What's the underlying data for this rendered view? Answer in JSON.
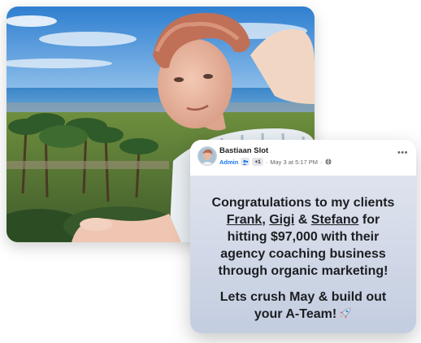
{
  "post": {
    "author": "Bastiaan Slot",
    "role_badge": "Admin",
    "member_count": "+1",
    "separator": "·",
    "date": "May 3 at 5:17 PM",
    "more_icon": "more-horizontal-icon",
    "text_line1": "Congratulations to my clients",
    "client1": "Frank",
    "comma": ", ",
    "client2": "Gigi",
    "amp": " & ",
    "client3": "Stefano",
    "text_line2_end": " for",
    "text_line3": "hitting $97,000 with their",
    "text_line4": "agency coaching business",
    "text_line5": "through organic marketing!",
    "text_line6": "Lets crush May & build out",
    "text_line7": "your A-Team!",
    "emoji": "rocket-icon"
  },
  "colors": {
    "facebook_blue": "#1877f2",
    "meta_gray": "#65676b",
    "text_dark": "#1c1e21",
    "body_gradient_top": "#dfe3ee",
    "body_gradient_bottom": "#c3cde0"
  }
}
